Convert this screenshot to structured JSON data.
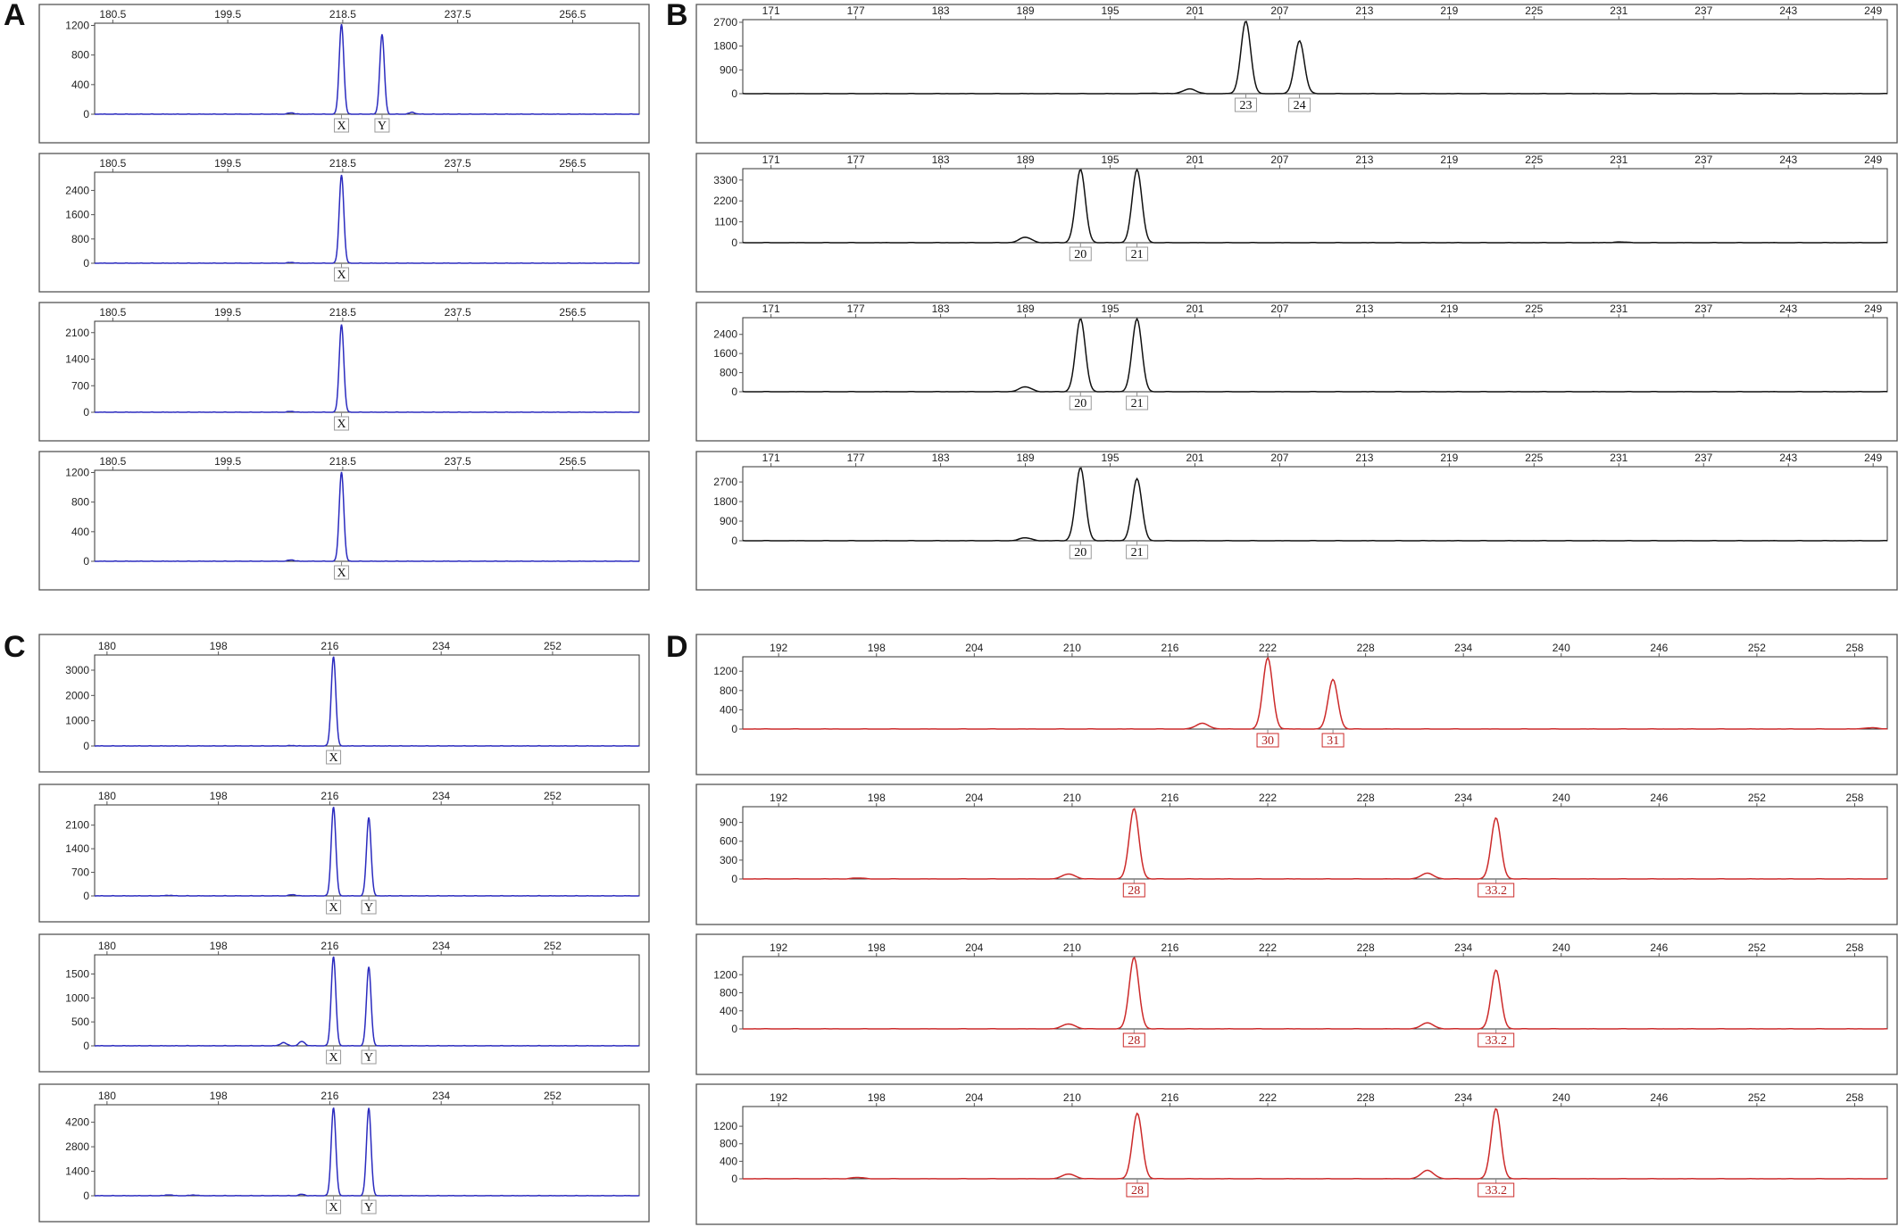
{
  "chart_data": [
    {
      "panel": "A",
      "type": "line",
      "color": "#2b2bbf",
      "x_ticks": [
        180.5,
        199.5,
        218.5,
        237.5,
        256.5
      ],
      "xlim": [
        177.5,
        267.5
      ],
      "traces": [
        {
          "y_ticks": [
            0,
            400,
            800,
            1200
          ],
          "ylim": [
            0,
            1230
          ],
          "peaks": [
            {
              "x": 218.3,
              "y": 1220,
              "label": "X"
            },
            {
              "x": 225.0,
              "y": 1080,
              "label": "Y"
            }
          ],
          "minor_peaks": [
            {
              "x": 210.0,
              "y": 20
            },
            {
              "x": 230.0,
              "y": 25
            }
          ]
        },
        {
          "y_ticks": [
            0,
            800,
            1600,
            2400
          ],
          "ylim": [
            0,
            3000
          ],
          "peaks": [
            {
              "x": 218.3,
              "y": 2920,
              "label": "X"
            }
          ],
          "minor_peaks": [
            {
              "x": 210.0,
              "y": 30
            }
          ]
        },
        {
          "y_ticks": [
            0,
            700,
            1400,
            2100
          ],
          "ylim": [
            0,
            2400
          ],
          "peaks": [
            {
              "x": 218.3,
              "y": 2320,
              "label": "X"
            }
          ],
          "minor_peaks": [
            {
              "x": 210.0,
              "y": 25
            }
          ]
        },
        {
          "y_ticks": [
            0,
            400,
            800,
            1200
          ],
          "ylim": [
            0,
            1230
          ],
          "peaks": [
            {
              "x": 218.3,
              "y": 1210,
              "label": "X"
            }
          ],
          "minor_peaks": [
            {
              "x": 210.0,
              "y": 20
            }
          ]
        }
      ]
    },
    {
      "panel": "B",
      "type": "line",
      "color": "#111111",
      "x_ticks": [
        171,
        177,
        183,
        189,
        195,
        201,
        207,
        213,
        219,
        225,
        231,
        237,
        243,
        249
      ],
      "xlim": [
        169,
        250
      ],
      "traces": [
        {
          "y_ticks": [
            0,
            900,
            1800,
            2700
          ],
          "ylim": [
            0,
            2800
          ],
          "peaks": [
            {
              "x": 204.6,
              "y": 2750,
              "label": "23"
            },
            {
              "x": 208.4,
              "y": 2000,
              "label": "24"
            }
          ],
          "minor_peaks": [
            {
              "x": 200.6,
              "y": 180
            },
            {
              "x": 198.0,
              "y": 20
            }
          ]
        },
        {
          "y_ticks": [
            0,
            1100,
            2200,
            3300
          ],
          "ylim": [
            0,
            3900
          ],
          "peaks": [
            {
              "x": 192.9,
              "y": 3850,
              "label": "20"
            },
            {
              "x": 196.9,
              "y": 3850,
              "label": "21"
            }
          ],
          "minor_peaks": [
            {
              "x": 189.0,
              "y": 280
            },
            {
              "x": 231.0,
              "y": 40
            }
          ]
        },
        {
          "y_ticks": [
            0,
            800,
            1600,
            2400
          ],
          "ylim": [
            0,
            3100
          ],
          "peaks": [
            {
              "x": 192.9,
              "y": 3050,
              "label": "20"
            },
            {
              "x": 196.9,
              "y": 3050,
              "label": "21"
            }
          ],
          "minor_peaks": [
            {
              "x": 189.0,
              "y": 200
            }
          ]
        },
        {
          "y_ticks": [
            0,
            900,
            1800,
            2700
          ],
          "ylim": [
            0,
            3400
          ],
          "peaks": [
            {
              "x": 192.9,
              "y": 3350,
              "label": "20"
            },
            {
              "x": 196.9,
              "y": 2850,
              "label": "21"
            }
          ],
          "minor_peaks": [
            {
              "x": 189.0,
              "y": 130
            }
          ]
        }
      ]
    },
    {
      "panel": "C",
      "type": "line",
      "color": "#2b2bbf",
      "x_ticks": [
        180,
        198,
        216,
        234,
        252
      ],
      "xlim": [
        178,
        266
      ],
      "traces": [
        {
          "y_ticks": [
            0,
            1000,
            2000,
            3000
          ],
          "ylim": [
            0,
            3600
          ],
          "peaks": [
            {
              "x": 216.6,
              "y": 3550,
              "label": "X"
            }
          ],
          "minor_peaks": [
            {
              "x": 210.0,
              "y": 20
            }
          ]
        },
        {
          "y_ticks": [
            0,
            700,
            1400,
            2100
          ],
          "ylim": [
            0,
            2700
          ],
          "peaks": [
            {
              "x": 216.6,
              "y": 2650,
              "label": "X"
            },
            {
              "x": 222.3,
              "y": 2330,
              "label": "Y"
            }
          ],
          "minor_peaks": [
            {
              "x": 210.0,
              "y": 40
            },
            {
              "x": 190.0,
              "y": 20
            }
          ]
        },
        {
          "y_ticks": [
            0,
            500,
            1000,
            1500
          ],
          "ylim": [
            0,
            1900
          ],
          "peaks": [
            {
              "x": 216.6,
              "y": 1870,
              "label": "X"
            },
            {
              "x": 222.3,
              "y": 1650,
              "label": "Y"
            }
          ],
          "minor_peaks": [
            {
              "x": 208.5,
              "y": 70
            },
            {
              "x": 211.5,
              "y": 90
            }
          ]
        },
        {
          "y_ticks": [
            0,
            1400,
            2800,
            4200
          ],
          "ylim": [
            0,
            5200
          ],
          "peaks": [
            {
              "x": 216.6,
              "y": 5050,
              "label": "X"
            },
            {
              "x": 222.3,
              "y": 5020,
              "label": "Y"
            }
          ],
          "minor_peaks": [
            {
              "x": 190.0,
              "y": 60
            },
            {
              "x": 194.0,
              "y": 50
            },
            {
              "x": 211.5,
              "y": 80
            }
          ]
        }
      ]
    },
    {
      "panel": "D",
      "type": "line",
      "color": "#cc2a2a",
      "x_ticks": [
        192,
        198,
        204,
        210,
        216,
        222,
        228,
        234,
        240,
        246,
        252,
        258
      ],
      "xlim": [
        189.8,
        260
      ],
      "traces": [
        {
          "y_ticks": [
            0,
            400,
            800,
            1200
          ],
          "ylim": [
            0,
            1500
          ],
          "peaks": [
            {
              "x": 222.0,
              "y": 1480,
              "label": "30"
            },
            {
              "x": 226.0,
              "y": 1030,
              "label": "31"
            }
          ],
          "minor_peaks": [
            {
              "x": 218.0,
              "y": 120
            },
            {
              "x": 259.0,
              "y": 30
            }
          ]
        },
        {
          "y_ticks": [
            0,
            300,
            600,
            900
          ],
          "ylim": [
            0,
            1150
          ],
          "peaks": [
            {
              "x": 213.8,
              "y": 1120,
              "label": "28"
            },
            {
              "x": 236.0,
              "y": 970,
              "label": "33.2"
            }
          ],
          "minor_peaks": [
            {
              "x": 209.8,
              "y": 80
            },
            {
              "x": 231.8,
              "y": 90
            },
            {
              "x": 196.8,
              "y": 15
            }
          ]
        },
        {
          "y_ticks": [
            0,
            400,
            800,
            1200
          ],
          "ylim": [
            0,
            1600
          ],
          "peaks": [
            {
              "x": 213.8,
              "y": 1580,
              "label": "28"
            },
            {
              "x": 236.0,
              "y": 1300,
              "label": "33.2"
            }
          ],
          "minor_peaks": [
            {
              "x": 209.8,
              "y": 110
            },
            {
              "x": 231.8,
              "y": 130
            }
          ]
        },
        {
          "y_ticks": [
            0,
            400,
            800,
            1200
          ],
          "ylim": [
            0,
            1650
          ],
          "peaks": [
            {
              "x": 214.0,
              "y": 1500,
              "label": "28"
            },
            {
              "x": 236.0,
              "y": 1600,
              "label": "33.2"
            }
          ],
          "minor_peaks": [
            {
              "x": 209.8,
              "y": 110
            },
            {
              "x": 231.8,
              "y": 190
            },
            {
              "x": 196.8,
              "y": 30
            }
          ]
        }
      ]
    }
  ]
}
